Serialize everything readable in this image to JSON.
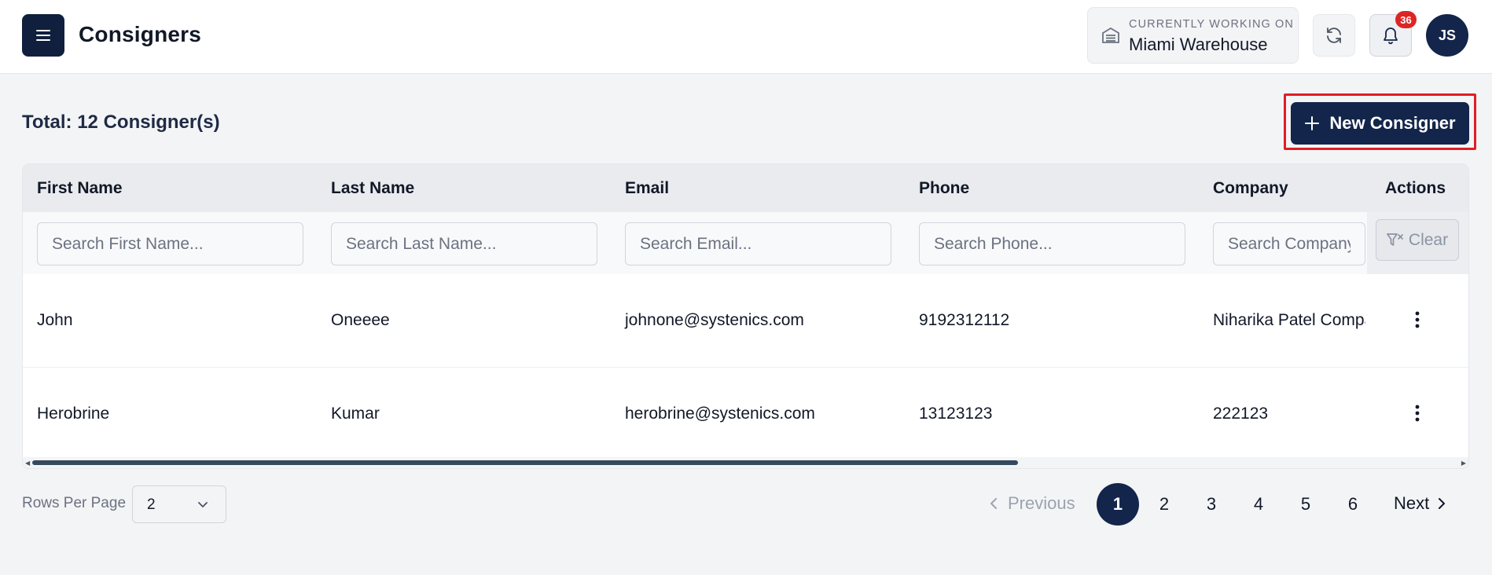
{
  "header": {
    "title": "Consigners",
    "workspace_label": "CURRENTLY WORKING ON",
    "workspace_value": "Miami Warehouse",
    "notifications_count": "36",
    "avatar_initials": "JS"
  },
  "toolbar": {
    "total_text": "Total: 12 Consigner(s)",
    "new_button_label": "New Consigner"
  },
  "table": {
    "columns": [
      "First Name",
      "Last Name",
      "Email",
      "Phone",
      "Company",
      "Actions"
    ],
    "filters": {
      "first_name_placeholder": "Search First Name...",
      "last_name_placeholder": "Search Last Name...",
      "email_placeholder": "Search Email...",
      "phone_placeholder": "Search Phone...",
      "company_placeholder": "Search Company...",
      "clear_label": "Clear"
    },
    "rows": [
      {
        "first_name": "John",
        "last_name": "Oneeee",
        "email": "johnone@systenics.com",
        "phone": "9192312112",
        "company": "Niharika Patel Company"
      },
      {
        "first_name": "Herobrine",
        "last_name": "Kumar",
        "email": "herobrine@systenics.com",
        "phone": "13123123",
        "company": "222123"
      }
    ]
  },
  "footer": {
    "rows_per_page_label": "Rows Per Page",
    "rows_per_page_value": "2",
    "previous_label": "Previous",
    "next_label": "Next",
    "pages": [
      "1",
      "2",
      "3",
      "4",
      "5",
      "6"
    ],
    "current_page": "1"
  },
  "colors": {
    "primary": "#13254a",
    "badge": "#dc2626",
    "highlight": "#e11d24"
  },
  "icons": [
    "menu-icon",
    "warehouse-icon",
    "refresh-icon",
    "bell-icon",
    "plus-icon",
    "filter-x-icon",
    "kebab-icon",
    "chevron-down-icon",
    "chevron-left-icon",
    "chevron-right-icon"
  ]
}
